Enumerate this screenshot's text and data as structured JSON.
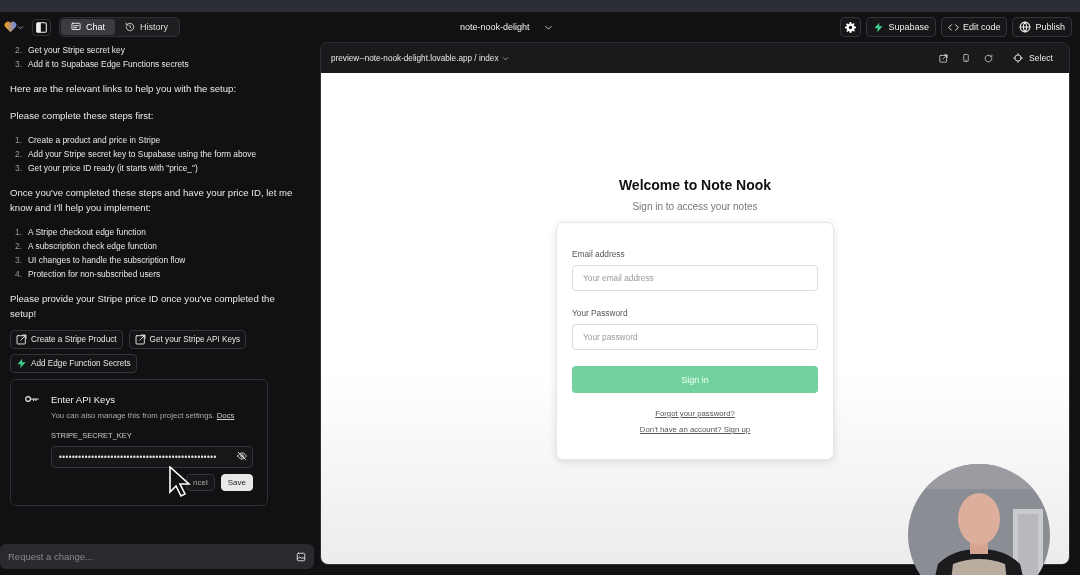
{
  "top_bar": {
    "tabs": [
      {
        "label": "Chat",
        "selected": true
      },
      {
        "label": "History",
        "selected": false
      }
    ],
    "project_name": "note-nook-delight",
    "buttons": [
      {
        "label": "Supabase",
        "kind": "supabase"
      },
      {
        "label": "Edit code",
        "kind": "code"
      },
      {
        "label": "Publish",
        "kind": "globe"
      }
    ]
  },
  "chat": {
    "blocks": [
      {
        "kind": "list",
        "items": [
          {
            "number": "2.",
            "text": "Get your Stripe secret key"
          },
          {
            "number": "3.",
            "text": "Add it to Supabase Edge Functions secrets"
          }
        ]
      },
      {
        "kind": "paragraph",
        "text": "Here are the relevant links to help you with the setup:"
      },
      {
        "kind": "paragraph",
        "text": "Please complete these steps first:"
      },
      {
        "kind": "list",
        "items": [
          {
            "number": "1.",
            "text": "Create a product and price in Stripe"
          },
          {
            "number": "2.",
            "text": "Add your Stripe secret key to Supabase using the form above"
          },
          {
            "number": "3.",
            "text": "Get your price ID ready (it starts with \"price_\")"
          }
        ]
      },
      {
        "kind": "paragraph",
        "text": "Once you've completed these steps and have your price ID, let me know and I'll help you implement:"
      },
      {
        "kind": "list",
        "items": [
          {
            "number": "1.",
            "text": "A Stripe checkout edge function"
          },
          {
            "number": "2.",
            "text": "A subscription check edge function"
          },
          {
            "number": "3.",
            "text": "UI changes to handle the subscription flow"
          },
          {
            "number": "4.",
            "text": "Protection for non-subscribed users"
          }
        ]
      },
      {
        "kind": "paragraph",
        "text": "Please provide your Stripe price ID once you've completed the setup!"
      }
    ],
    "action_buttons": [
      {
        "label": "Create a Stripe Product",
        "kind": "external"
      },
      {
        "label": "Get your Stripe API Keys",
        "kind": "external"
      },
      {
        "label": "Add Edge Function Secrets",
        "kind": "bolt"
      }
    ],
    "api_keys_card": {
      "title": "Enter API Keys",
      "description": "You can also manage this from project settings.",
      "link": "Docs",
      "field_label": "STRIPE_SECRET_KEY",
      "value": "•••••••••••••••••••••••••••••••••••••••••••••••••",
      "buttons": [
        {
          "label": "ncel",
          "kind": "cancel"
        },
        {
          "label": "Save",
          "kind": "save"
        }
      ]
    },
    "request_field": {
      "placeholder": "Request a change..."
    }
  },
  "preview": {
    "address": "preview--note-nook-delight.lovable.app / index",
    "select_label": "Select",
    "login": {
      "title": "Welcome to Note Nook",
      "subtitle": "Sign in to access your notes",
      "fields": [
        {
          "label": "Email address",
          "placeholder": "Your email address"
        },
        {
          "label": "Your Password",
          "placeholder": "Your password"
        }
      ],
      "submit": "Sign in",
      "links": [
        "Forgot your password?",
        "Don't have an account? Sign up"
      ]
    }
  }
}
